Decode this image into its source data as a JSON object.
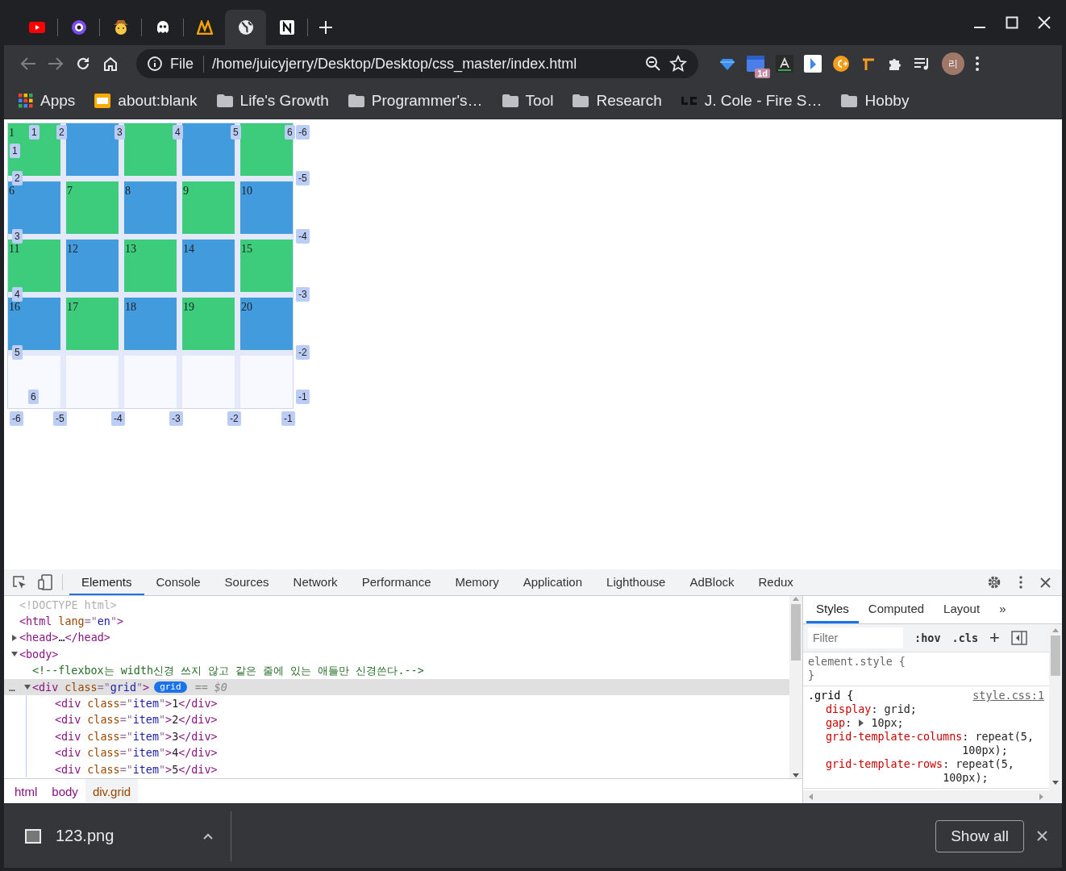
{
  "browser": {
    "tabs": [
      {
        "kind": "video",
        "selected": false
      },
      {
        "kind": "ring",
        "selected": false
      },
      {
        "kind": "face",
        "selected": false
      },
      {
        "kind": "ghost",
        "selected": false
      },
      {
        "kind": "peaks",
        "selected": false
      },
      {
        "kind": "globe",
        "selected": true
      },
      {
        "kind": "notes",
        "selected": false
      }
    ],
    "address": {
      "scheme": "File",
      "url": "/home/juicyjerry/Desktop/Desktop/css_master/index.html"
    },
    "extension_badge": "1d",
    "avatar": "리",
    "bookmarks": [
      {
        "kind": "apps",
        "label": "Apps"
      },
      {
        "kind": "page",
        "label": "about:blank"
      },
      {
        "kind": "folder",
        "label": "Life's Growth"
      },
      {
        "kind": "folder",
        "label": "Programmer's…"
      },
      {
        "kind": "folder",
        "label": "Tool"
      },
      {
        "kind": "folder",
        "label": "Research"
      },
      {
        "kind": "brand",
        "label": "J. Cole - Fire S…"
      },
      {
        "kind": "folder",
        "label": "Hobby"
      }
    ]
  },
  "page": {
    "cells": [
      {
        "text": "1",
        "color": "#3ccc7c"
      },
      {
        "color": "#419bdc"
      },
      {
        "color": "#3ccc7c"
      },
      {
        "color": "#419bdc"
      },
      {
        "color": "#3ccc7c"
      },
      {
        "text": "6",
        "color": "#419bdc"
      },
      {
        "text": "7",
        "color": "#3ccc7c"
      },
      {
        "text": "8",
        "color": "#419bdc"
      },
      {
        "text": "9",
        "color": "#3ccc7c"
      },
      {
        "text": "10",
        "color": "#419bdc"
      },
      {
        "text": "11",
        "color": "#3ccc7c"
      },
      {
        "text": "12",
        "color": "#419bdc"
      },
      {
        "text": "13",
        "color": "#3ccc7c"
      },
      {
        "text": "14",
        "color": "#419bdc"
      },
      {
        "text": "15",
        "color": "#3ccc7c"
      },
      {
        "text": "16",
        "color": "#419bdc"
      },
      {
        "text": "17",
        "color": "#3ccc7c"
      },
      {
        "text": "18",
        "color": "#419bdc"
      },
      {
        "text": "19",
        "color": "#3ccc7c"
      },
      {
        "text": "20",
        "color": "#419bdc"
      }
    ],
    "column_lines": [
      "1",
      "2",
      "3",
      "4",
      "5",
      "6"
    ],
    "row_lines": [
      "1",
      "2",
      "3",
      "4",
      "5",
      "6"
    ],
    "row_lines_negative": [
      "-6",
      "-5",
      "-4",
      "-3",
      "-2",
      "-1"
    ],
    "column_lines_negative": [
      "-6",
      "-5",
      "-4",
      "-3",
      "-2",
      "-1"
    ]
  },
  "devtools": {
    "tabs": [
      {
        "label": "Elements",
        "selected": true
      },
      {
        "label": "Console",
        "selected": false
      },
      {
        "label": "Sources",
        "selected": false
      },
      {
        "label": "Network",
        "selected": false
      },
      {
        "label": "Performance",
        "selected": false
      },
      {
        "label": "Memory",
        "selected": false
      },
      {
        "label": "Application",
        "selected": false
      },
      {
        "label": "Lighthouse",
        "selected": false
      },
      {
        "label": "AdBlock",
        "selected": false
      },
      {
        "label": "Redux",
        "selected": false
      }
    ],
    "dom": [
      {
        "segs": [
          {
            "kind": "doctype",
            "text": "<!DOCTYPE html>"
          }
        ]
      },
      {
        "segs": [
          {
            "kind": "tag",
            "text": "<html"
          },
          {
            "kind": "attr",
            "text": " lang"
          },
          {
            "kind": "punct",
            "text": "=\""
          },
          {
            "kind": "value",
            "text": "en"
          },
          {
            "kind": "punct",
            "text": "\""
          },
          {
            "kind": "tag",
            "text": ">"
          }
        ],
        "children": [
          {
            "segs": [
              {
                "kind": "tag",
                "text": "<head>"
              },
              {
                "kind": "text",
                "text": "…"
              },
              {
                "kind": "tag",
                "text": "</head>"
              }
            ],
            "expanded": false
          },
          {
            "segs": [
              {
                "kind": "tag",
                "text": "<body>"
              }
            ],
            "expanded": true,
            "children": [
              {
                "segs": [
                  {
                    "kind": "comment",
                    "text": "<!--flexbox는 width신경 쓰지 않고 같은 줄에 있는 애들만 신경쓴다.-->"
                  }
                ]
              },
              {
                "segs": [
                  {
                    "kind": "tag",
                    "text": "<div"
                  },
                  {
                    "kind": "attr",
                    "text": " class"
                  },
                  {
                    "kind": "punct",
                    "text": "=\""
                  },
                  {
                    "kind": "value",
                    "text": "grid"
                  },
                  {
                    "kind": "punct",
                    "text": "\""
                  },
                  {
                    "kind": "tag",
                    "text": ">"
                  }
                ],
                "expanded": true,
                "selected": true,
                "badge": "grid",
                "ref": "== $0",
                "more": "…",
                "children": [
                  {
                    "segs": [
                      {
                        "kind": "tag",
                        "text": "<div"
                      },
                      {
                        "kind": "attr",
                        "text": " class"
                      },
                      {
                        "kind": "punct",
                        "text": "=\""
                      },
                      {
                        "kind": "value",
                        "text": "item"
                      },
                      {
                        "kind": "punct",
                        "text": "\""
                      },
                      {
                        "kind": "tag",
                        "text": ">"
                      },
                      {
                        "kind": "text",
                        "text": "1"
                      },
                      {
                        "kind": "tag",
                        "text": "</div>"
                      }
                    ]
                  },
                  {
                    "segs": [
                      {
                        "kind": "tag",
                        "text": "<div"
                      },
                      {
                        "kind": "attr",
                        "text": " class"
                      },
                      {
                        "kind": "punct",
                        "text": "=\""
                      },
                      {
                        "kind": "value",
                        "text": "item"
                      },
                      {
                        "kind": "punct",
                        "text": "\""
                      },
                      {
                        "kind": "tag",
                        "text": ">"
                      },
                      {
                        "kind": "text",
                        "text": "2"
                      },
                      {
                        "kind": "tag",
                        "text": "</div>"
                      }
                    ]
                  },
                  {
                    "segs": [
                      {
                        "kind": "tag",
                        "text": "<div"
                      },
                      {
                        "kind": "attr",
                        "text": " class"
                      },
                      {
                        "kind": "punct",
                        "text": "=\""
                      },
                      {
                        "kind": "value",
                        "text": "item"
                      },
                      {
                        "kind": "punct",
                        "text": "\""
                      },
                      {
                        "kind": "tag",
                        "text": ">"
                      },
                      {
                        "kind": "text",
                        "text": "3"
                      },
                      {
                        "kind": "tag",
                        "text": "</div>"
                      }
                    ]
                  },
                  {
                    "segs": [
                      {
                        "kind": "tag",
                        "text": "<div"
                      },
                      {
                        "kind": "attr",
                        "text": " class"
                      },
                      {
                        "kind": "punct",
                        "text": "=\""
                      },
                      {
                        "kind": "value",
                        "text": "item"
                      },
                      {
                        "kind": "punct",
                        "text": "\""
                      },
                      {
                        "kind": "tag",
                        "text": ">"
                      },
                      {
                        "kind": "text",
                        "text": "4"
                      },
                      {
                        "kind": "tag",
                        "text": "</div>"
                      }
                    ]
                  },
                  {
                    "segs": [
                      {
                        "kind": "tag",
                        "text": "<div"
                      },
                      {
                        "kind": "attr",
                        "text": " class"
                      },
                      {
                        "kind": "punct",
                        "text": "=\""
                      },
                      {
                        "kind": "value",
                        "text": "item"
                      },
                      {
                        "kind": "punct",
                        "text": "\""
                      },
                      {
                        "kind": "tag",
                        "text": ">"
                      },
                      {
                        "kind": "text",
                        "text": "5"
                      },
                      {
                        "kind": "tag",
                        "text": "</div>"
                      }
                    ]
                  }
                ]
              }
            ]
          }
        ]
      }
    ],
    "breadcrumbs": [
      {
        "label": "html",
        "selected": false
      },
      {
        "label": "body",
        "selected": false
      },
      {
        "label": "div.grid",
        "selected": true
      }
    ],
    "styles": {
      "tabs": [
        {
          "label": "Styles",
          "selected": true
        },
        {
          "label": "Computed",
          "selected": false
        },
        {
          "label": "Layout",
          "selected": false
        }
      ],
      "more": "»",
      "filter": {
        "placeholder": "Filter"
      },
      "hov": ":hov",
      "cls": ".cls",
      "plus": "+",
      "rules": [
        {
          "selector": "element.style {",
          "close": "}"
        },
        {
          "selector": ".grid {",
          "source": "style.css:1",
          "decls": [
            {
              "prop": "display",
              "colon": ":",
              "value": "grid;"
            },
            {
              "prop": "gap",
              "colon": ":",
              "value": "10px;",
              "expanded": false
            },
            {
              "prop": "grid-template-columns",
              "colon": ":",
              "value": "repeat(5, 100px);"
            },
            {
              "prop": "grid-template-rows",
              "colon": ":",
              "value": "repeat(5, 100px);"
            }
          ]
        }
      ]
    }
  },
  "downloads": {
    "file": "123.png",
    "show_all": "Show all"
  }
}
